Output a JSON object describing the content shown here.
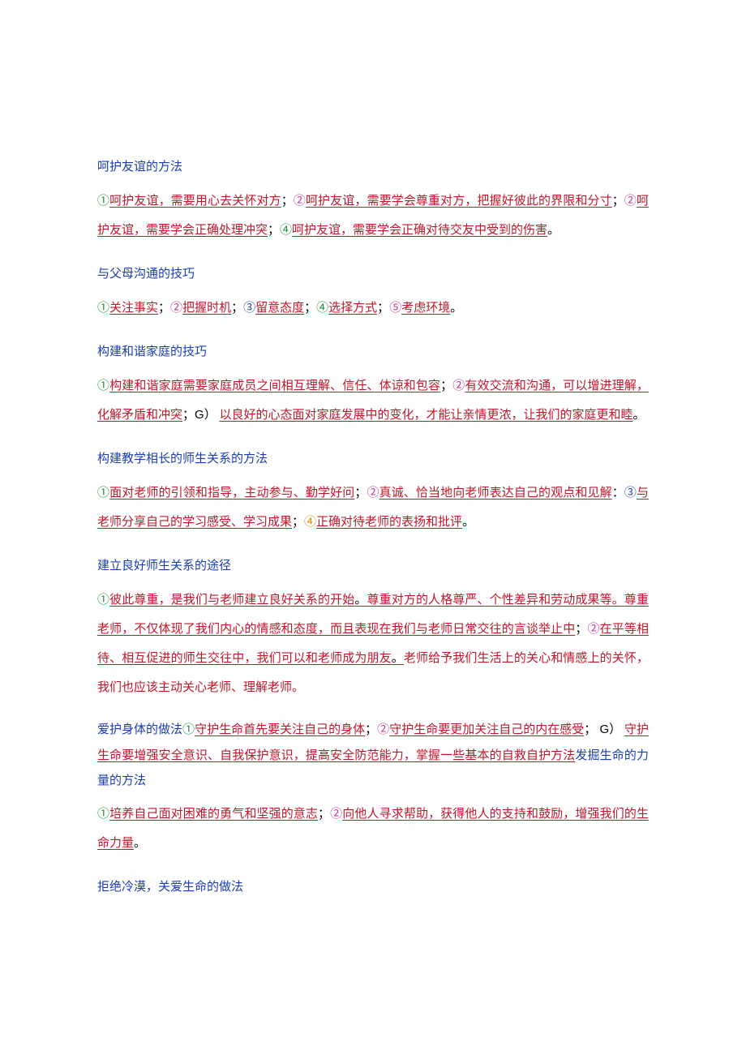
{
  "sections": {
    "s1": {
      "heading": "呵护友谊的方法",
      "n1": "①",
      "t1": "呵护友谊，需要用心去关怀对方",
      "sep1": "；",
      "n2": "②",
      "t2": "呵护友谊，需要学会尊重对方，把握好彼此的界限和分寸",
      "sep2": "；",
      "n3": "②",
      "t3": "呵护友谊，需要学会正确处理冲突",
      "sep3": "；",
      "n4": "④",
      "t4": "呵护友谊，需要学会正确对待交友中受到的伤害",
      "end": "。"
    },
    "s2": {
      "heading": "与父母沟通的技巧",
      "n1": "①",
      "t1": "关注事实",
      "sep1": "；",
      "n2": "②",
      "t2": "把握时机",
      "sep2": "；",
      "n3": "③",
      "t3": "留意态度",
      "sep3": "；",
      "n4": "④",
      "t4": "选择方式",
      "sep4": "；",
      "n5": "⑤",
      "t5": "考虑环境",
      "end": "。"
    },
    "s3": {
      "heading": "构建和谐家庭的技巧",
      "n1": "①",
      "t1": "构建和谐家庭需要家庭成员之间相互理解、信任、体谅和包容",
      "sep1": "；",
      "n2": "②",
      "t2": "有效交流和沟通，可以增进理解，化解矛盾和冲突",
      "sep2": "；",
      "g": "G）",
      "t3": "以良好的心态面对家庭发展中的变化，才能让亲情更浓，让我们的家庭更和睦",
      "end": "。"
    },
    "s4": {
      "heading": "构建教学相长的师生关系的方法",
      "n1": "①",
      "t1": "面对老师的引领和指导，主动参与、勤学好问",
      "sep1": "；",
      "n2": "②",
      "t2": "真诚、恰当地向老师表达自己的观点和见解",
      "sep2": "：",
      "n3": "③",
      "t3": "与老师分享自己的学习感受、学习成果",
      "sep3": "；",
      "n4": "④",
      "t4": "正确对待老师的表扬和批评",
      "end": "。"
    },
    "s5": {
      "heading": "建立良好师生关系的途径",
      "n1": "①",
      "t1a": "彼此尊重，是我们与老师建立良好关系的开始",
      "punct1": "。",
      "t1b": "尊重对方的人格尊严、个性差异和劳动成果等。尊重老师，不仅体现了我们内心的情感和态度，而且表现在我们与老师日常交往的言谈举止中",
      "sep1": "；",
      "n2": "②",
      "t2a": "在平等相待、相互促进的师生交往中，我们可以和老师成为朋友",
      "punct2": "。",
      "t2b": "老师给予我们生活上的关心和情感上的关怀，我们也应该主动关心老师、理解老师。"
    },
    "s6": {
      "heading": "爱护身体的做法",
      "n1": "①",
      "t1": "守护生命首先要关注自己的身体",
      "sep1": "；",
      "n2": "②",
      "t2": "守护生命要更加关注自己的内在感受",
      "sep2": "；",
      "g": " G）",
      "t3": "守护生命要增强安全意识、自我保护意识，提高安全防范能力，掌握一些基本的自救自护方法",
      "heading2": "发掘生命的力量的方法"
    },
    "s7": {
      "n1": "①",
      "t1": "培养自己面对困难的勇气和坚强的意志",
      "sep1": "；",
      "n2": "②",
      "t2": "向他人寻求帮助，获得他人的支持和鼓励，增强我们的生命力量",
      "end": "。"
    },
    "s8": {
      "heading": "拒绝冷漠，关爱生命的做法"
    }
  }
}
